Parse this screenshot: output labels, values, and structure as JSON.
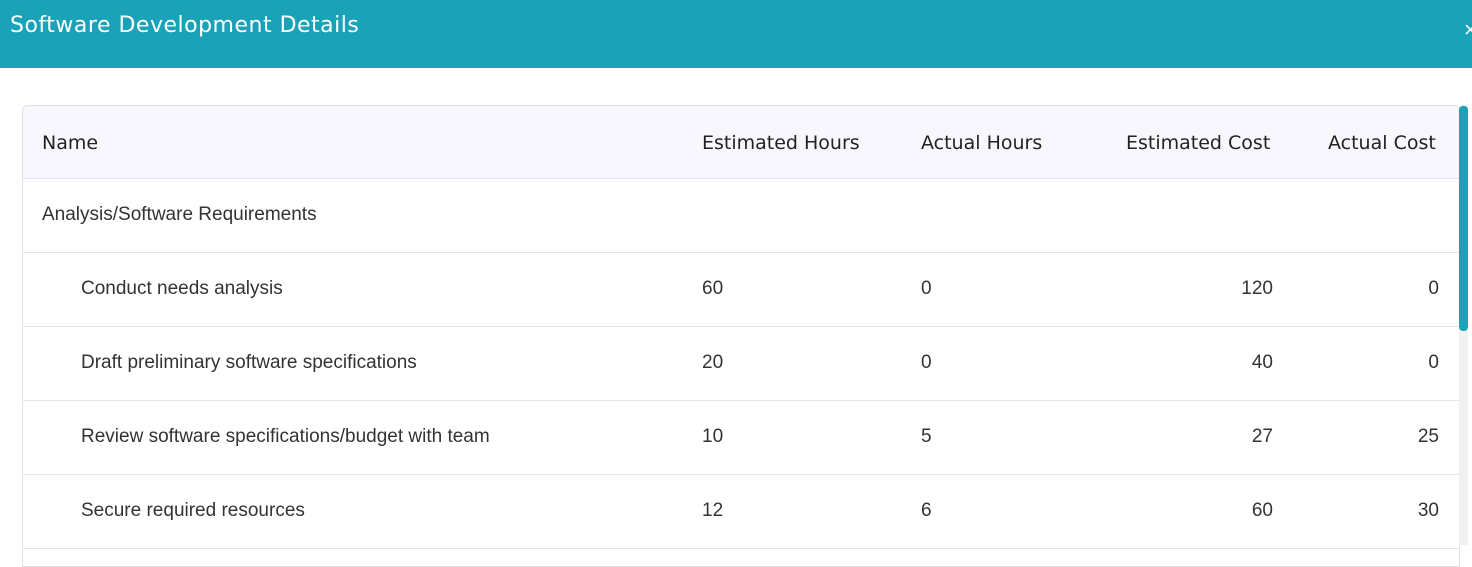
{
  "dialog": {
    "title": "Software Development Details",
    "close_icon": "close-icon"
  },
  "colors": {
    "header_bg": "#19a2b8",
    "grid_header_bg": "#f7f7fd",
    "scroll_thumb": "#19a2b8"
  },
  "grid": {
    "columns": [
      "Name",
      "Estimated Hours",
      "Actual Hours",
      "Estimated Cost",
      "Actual Cost"
    ],
    "group": "Analysis/Software Requirements",
    "rows": [
      {
        "name": "Conduct needs analysis",
        "est_hours": "60",
        "act_hours": "0",
        "est_cost": "120",
        "act_cost": "0"
      },
      {
        "name": "Draft preliminary software specifications",
        "est_hours": "20",
        "act_hours": "0",
        "est_cost": "40",
        "act_cost": "0"
      },
      {
        "name": "Review software specifications/budget with team",
        "est_hours": "10",
        "act_hours": "5",
        "est_cost": "27",
        "act_cost": "25"
      },
      {
        "name": "Secure required resources",
        "est_hours": "12",
        "act_hours": "6",
        "est_cost": "60",
        "act_cost": "30"
      }
    ]
  }
}
